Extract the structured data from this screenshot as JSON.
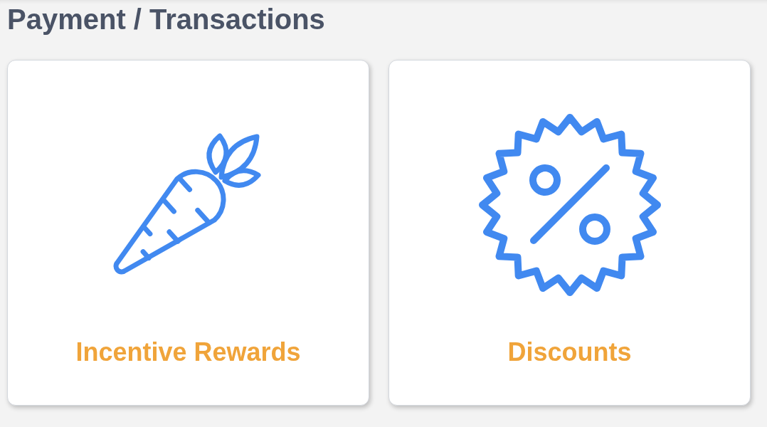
{
  "title": "Payment / Transactions",
  "cards": [
    {
      "label": "Incentive Rewards"
    },
    {
      "label": "Discounts"
    }
  ]
}
